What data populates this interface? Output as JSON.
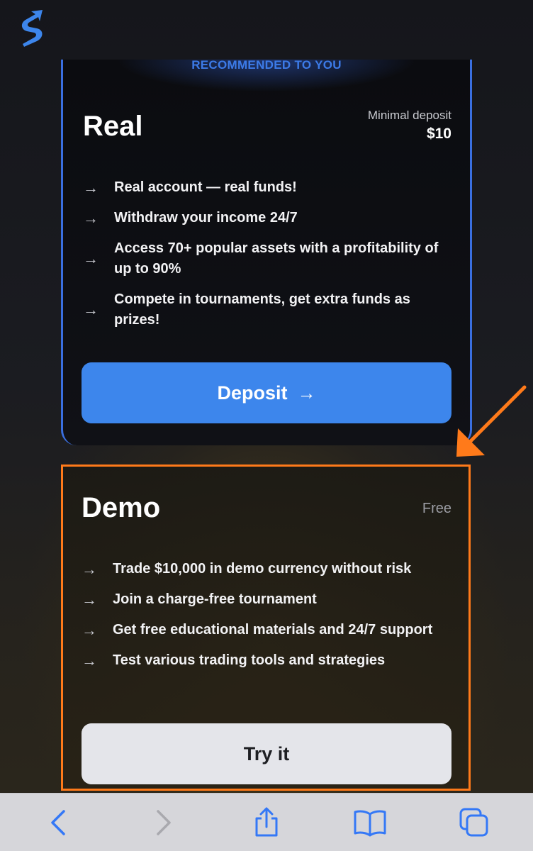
{
  "colors": {
    "accent_blue": "#3d86ec",
    "highlight_orange": "#ff7a1a",
    "card_background": "#0b0c10",
    "try_button": "#e4e5ea"
  },
  "logo": {
    "icon": "brand-logo-icon"
  },
  "real": {
    "badge": "RECOMMENDED TO YOU",
    "title": "Real",
    "deposit_label": "Minimal deposit",
    "deposit_value": "$10",
    "features": [
      "Real account — real funds!",
      "Withdraw your income 24/7",
      "Access 70+ popular assets with a profitability of up to 90%",
      "Compete in tournaments, get extra funds as prizes!"
    ],
    "button_label": "Deposit",
    "button_arrow": "→"
  },
  "demo": {
    "title": "Demo",
    "price_label": "Free",
    "features": [
      "Trade $10,000 in demo currency without risk",
      "Join a charge-free tournament",
      "Get free educational materials and 24/7 support",
      "Test various trading tools and strategies"
    ],
    "button_label": "Try it"
  },
  "feature_arrow": "→",
  "toolbar": {
    "items": [
      "back-icon",
      "forward-icon",
      "share-icon",
      "bookmarks-icon",
      "tabs-icon"
    ]
  }
}
